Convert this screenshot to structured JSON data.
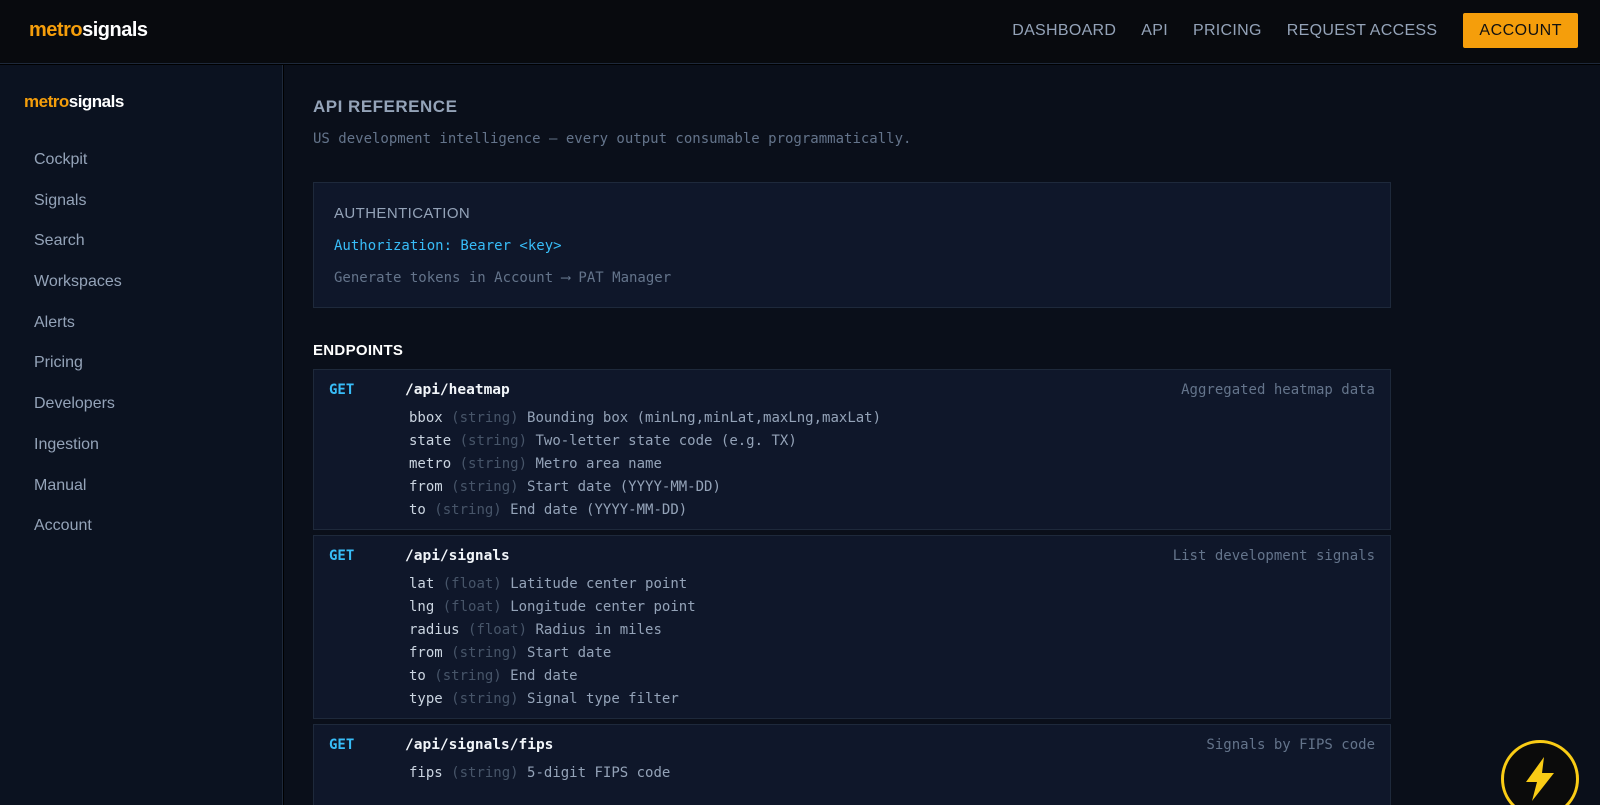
{
  "brand": {
    "part1": "metro",
    "part2": "signals"
  },
  "topnav": {
    "links": [
      "DASHBOARD",
      "API",
      "PRICING",
      "REQUEST ACCESS"
    ],
    "account": "ACCOUNT"
  },
  "sidebar": {
    "items": [
      "Cockpit",
      "Signals",
      "Search",
      "Workspaces",
      "Alerts",
      "Pricing",
      "Developers",
      "Ingestion",
      "Manual",
      "Account"
    ]
  },
  "page": {
    "title": "API REFERENCE",
    "subtitle": "US development intelligence — every output consumable programmatically."
  },
  "auth": {
    "title": "AUTHENTICATION",
    "header": "Authorization: Bearer <key>",
    "note": "Generate tokens in Account ⟶ PAT Manager"
  },
  "endpoints_title": "ENDPOINTS",
  "endpoints": [
    {
      "method": "GET",
      "path": "/api/heatmap",
      "desc": "Aggregated heatmap data",
      "params": [
        {
          "name": "bbox",
          "type": "(string)",
          "desc": "Bounding box (minLng,minLat,maxLng,maxLat)"
        },
        {
          "name": "state",
          "type": "(string)",
          "desc": "Two-letter state code (e.g. TX)"
        },
        {
          "name": "metro",
          "type": "(string)",
          "desc": "Metro area name"
        },
        {
          "name": "from",
          "type": "(string)",
          "desc": "Start date (YYYY-MM-DD)"
        },
        {
          "name": "to",
          "type": "(string)",
          "desc": "End date (YYYY-MM-DD)"
        }
      ]
    },
    {
      "method": "GET",
      "path": "/api/signals",
      "desc": "List development signals",
      "params": [
        {
          "name": "lat",
          "type": "(float)",
          "desc": "Latitude center point"
        },
        {
          "name": "lng",
          "type": "(float)",
          "desc": "Longitude center point"
        },
        {
          "name": "radius",
          "type": "(float)",
          "desc": "Radius in miles"
        },
        {
          "name": "from",
          "type": "(string)",
          "desc": "Start date"
        },
        {
          "name": "to",
          "type": "(string)",
          "desc": "End date"
        },
        {
          "name": "type",
          "type": "(string)",
          "desc": "Signal type filter"
        }
      ]
    },
    {
      "method": "GET",
      "path": "/api/signals/fips",
      "desc": "Signals by FIPS code",
      "params": [
        {
          "name": "fips",
          "type": "(string)",
          "desc": "5-digit FIPS code"
        }
      ]
    }
  ],
  "colors": {
    "accent": "#f59e0b",
    "method": "#38bdf8",
    "fab_ring": "#facc15"
  },
  "icons": {
    "fab": "lightning-bolt-icon"
  }
}
